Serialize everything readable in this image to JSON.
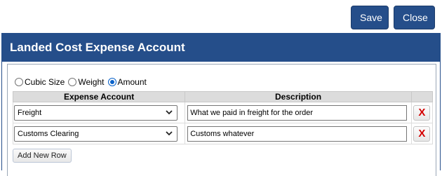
{
  "toolbar": {
    "save_label": "Save",
    "close_label": "Close"
  },
  "panel": {
    "title": "Landed Cost Expense Account"
  },
  "allocation": {
    "options": [
      {
        "label": "Cubic Size",
        "checked": false
      },
      {
        "label": "Weight",
        "checked": false
      },
      {
        "label": "Amount",
        "checked": true
      }
    ]
  },
  "table": {
    "headers": [
      "Expense Account",
      "Description",
      ""
    ],
    "rows": [
      {
        "account": "Freight",
        "description": "What we paid in freight for the order",
        "delete_label": "X"
      },
      {
        "account": "Customs Clearing",
        "description": "Customs whatever",
        "delete_label": "X"
      }
    ]
  },
  "add_row_label": "Add New Row",
  "colors": {
    "brand": "#254e8a",
    "delete": "#d40000",
    "radio_checked": "#0a62c9"
  },
  "icons": {
    "dropdown": "chevron-down-icon",
    "delete": "close-icon"
  }
}
